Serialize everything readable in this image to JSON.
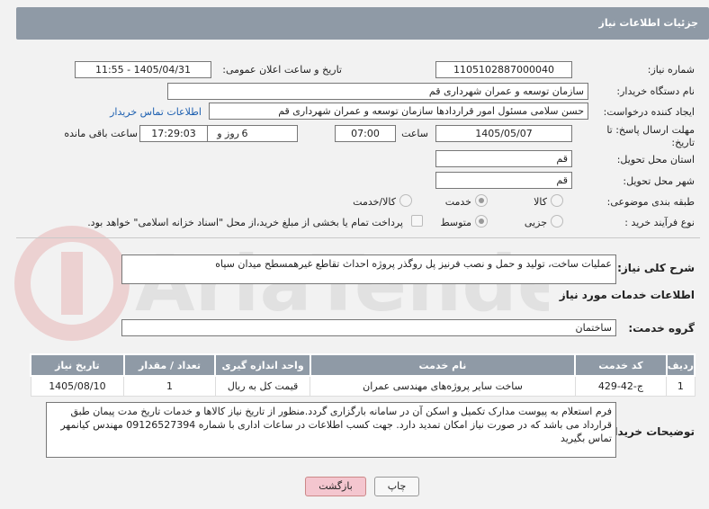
{
  "header": {
    "title": "جزئیات اطلاعات نیاز"
  },
  "fields": {
    "need_number_label": "شماره نیاز:",
    "need_number": "1105102887000040",
    "announce_label": "تاریخ و ساعت اعلان عمومی:",
    "announce_value": "1405/04/31 - 11:55",
    "buyer_org_label": "نام دستگاه خریدار:",
    "buyer_org": "سازمان توسعه و عمران شهرداری قم",
    "requester_label": "ایجاد کننده درخواست:",
    "requester": "حسن سلامی مسئول امور قراردادها سازمان توسعه و عمران شهرداری قم",
    "contact_link": "اطلاعات تماس خریدار",
    "deadline_label_1": "مهلت ارسال پاسخ: تا",
    "deadline_label_2": "تاریخ:",
    "deadline_date": "1405/05/07",
    "time_label": "ساعت",
    "deadline_time": "07:00",
    "days_value": "6",
    "days_label": "روز و",
    "remaining_time": "17:29:03",
    "remaining_label": "ساعت باقی مانده",
    "province_label": "استان محل تحویل:",
    "province": "قم",
    "city_label": "شهر محل تحویل:",
    "city": "قم",
    "category_label": "طبقه بندی موضوعی:",
    "category_options": [
      "کالا",
      "خدمت",
      "کالا/خدمت"
    ],
    "category_selected": "خدمت",
    "process_label": "نوع فرآیند خرید :",
    "process_options": [
      "جزیی",
      "متوسط"
    ],
    "process_selected": "متوسط",
    "payment_note": "پرداخت تمام یا بخشی از مبلغ خرید،از محل \"اسناد خزانه اسلامی\" خواهد بود."
  },
  "summary": {
    "label": "شرح کلی نیاز:",
    "text": "عملیات ساخت، تولید و حمل و نصب فرنیز پل روگذر پروژه احداث تقاطع غیرهمسطح میدان سپاه"
  },
  "services": {
    "section_title": "اطلاعات خدمات مورد نیاز",
    "group_label": "گروه خدمت:",
    "group_value": "ساختمان",
    "columns": [
      "ردیف",
      "کد خدمت",
      "نام خدمت",
      "واحد اندازه گیری",
      "تعداد / مقدار",
      "تاریخ نیاز"
    ],
    "rows": [
      {
        "row": "1",
        "code": "ج-42-429",
        "name": "ساخت سایر پروژه‌های مهندسی عمران",
        "unit": "قیمت کل به ریال",
        "qty": "1",
        "date": "1405/08/10"
      }
    ]
  },
  "buyer_notes": {
    "label": "توضیحات خریدار:",
    "text": "فرم استعلام به پیوست مدارک تکمیل و اسکن آن در سامانه بارگزاری گردد.منظور از تاریخ نیاز کالاها و خدمات تاریخ مدت پیمان طبق قرارداد می باشد که در صورت نیاز امکان تمدید دارد. جهت کسب اطلاعات در ساعات اداری با شماره 09126527394 مهندس کیانمهر تماس بگیرید"
  },
  "buttons": {
    "print": "چاپ",
    "back": "بازگشت"
  },
  "watermark": {
    "text": "AriaTender.neT"
  }
}
